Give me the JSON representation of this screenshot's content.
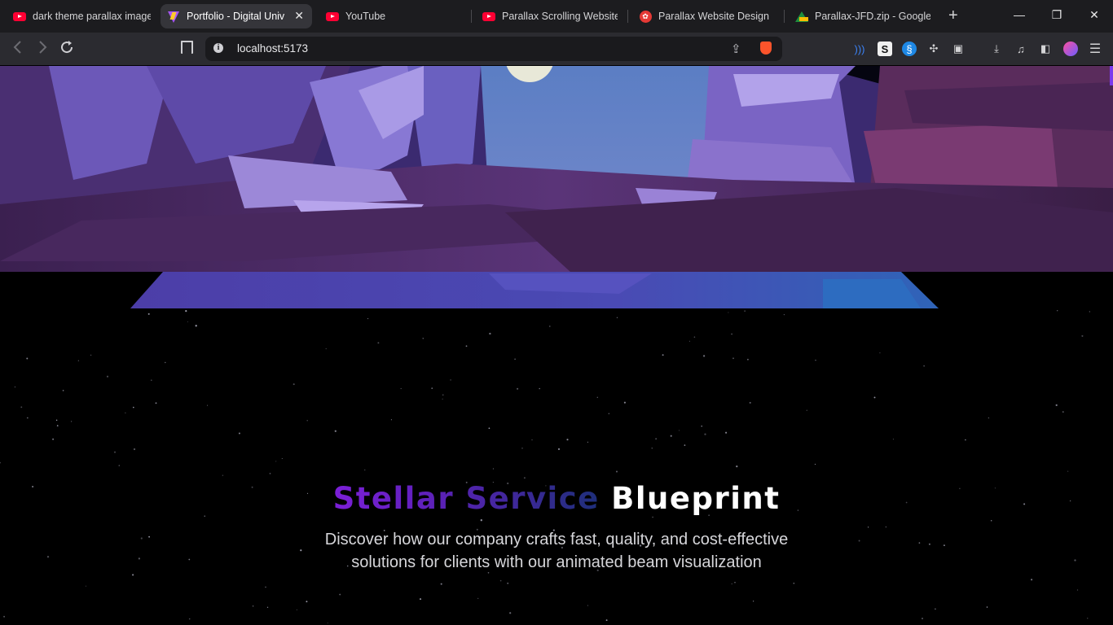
{
  "browser": {
    "tabs": [
      {
        "title": "dark theme parallax images",
        "icon": "youtube-icon",
        "active": false
      },
      {
        "title": "Portfolio - Digital Univ",
        "icon": "vite-icon",
        "active": true
      },
      {
        "title": "YouTube",
        "icon": "youtube-icon",
        "active": false
      },
      {
        "title": "Parallax Scrolling Website u",
        "icon": "youtube-icon",
        "active": false
      },
      {
        "title": "Parallax Website Design in",
        "icon": "red-circle-icon",
        "active": false
      },
      {
        "title": "Parallax-JFD.zip - Google D",
        "icon": "google-drive-icon",
        "active": false
      }
    ],
    "address": "localhost:5173",
    "new_tab_symbol": "+",
    "window_controls": [
      "—",
      "❐",
      "✕"
    ]
  },
  "page": {
    "headline": {
      "gradient_part": "Stellar Service",
      "plain_part": "Blueprint"
    },
    "subtitle_line1": "Discover how our company crafts fast, quality, and cost-effective",
    "subtitle_line2": "solutions for clients with our animated beam visualization",
    "colors": {
      "background": "#000000",
      "gradient_start": "#7c1fd8",
      "gradient_end": "#1e2f7a",
      "accent_scroll": "#7c3aed"
    }
  }
}
